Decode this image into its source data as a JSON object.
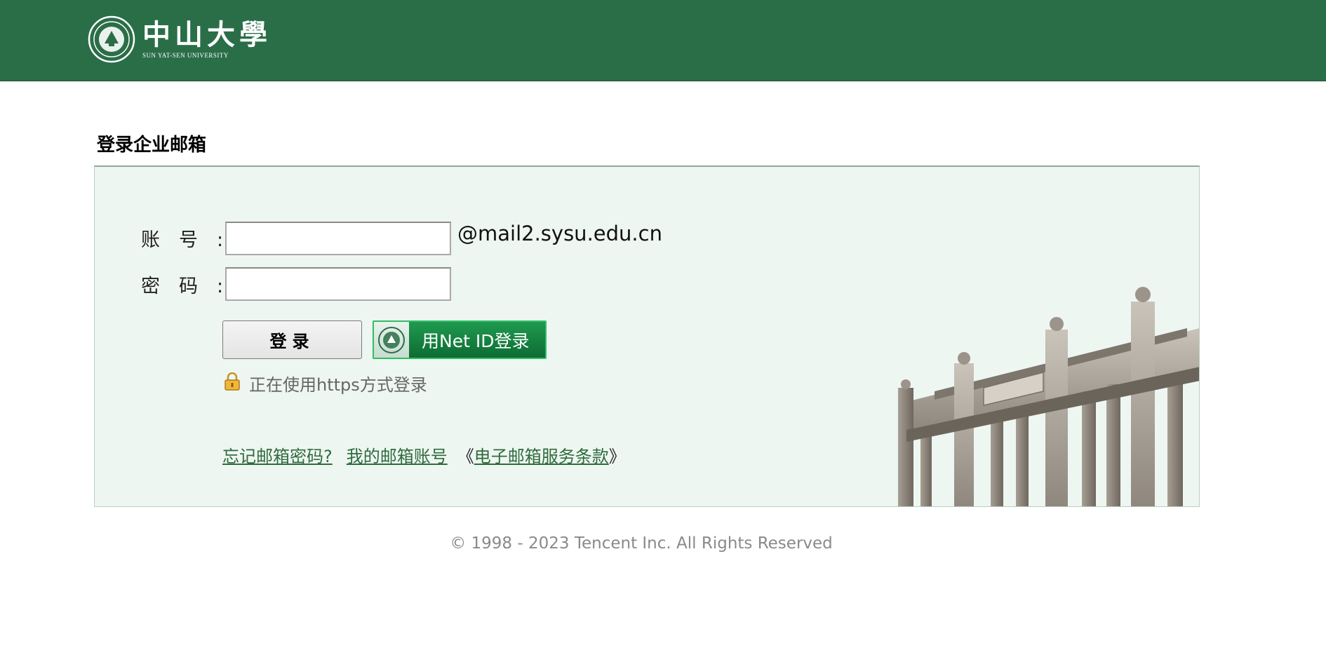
{
  "header": {
    "logo_cn": "中山大學",
    "logo_en": "SUN YAT-SEN UNIVERSITY",
    "seal_icon": "university-seal-icon",
    "background_color": "#2a6e48"
  },
  "page_title": "登录企业邮箱",
  "form": {
    "account_label": "账号",
    "password_label": "密码",
    "colon": ":",
    "account_value": "",
    "password_value": "",
    "domain_suffix": "@mail2.sysu.edu.cn",
    "login_button": "登录",
    "netid_button": "用Net ID登录",
    "https_note": "正在使用https方式登录",
    "lock_icon": "lock-icon"
  },
  "links": {
    "forgot_password": "忘记邮箱密码?",
    "my_account": "我的邮箱账号",
    "open_bracket": "《",
    "terms": "电子邮箱服务条款",
    "close_bracket": "》"
  },
  "footer": "© 1998 - 2023 Tencent Inc. All Rights Reserved"
}
